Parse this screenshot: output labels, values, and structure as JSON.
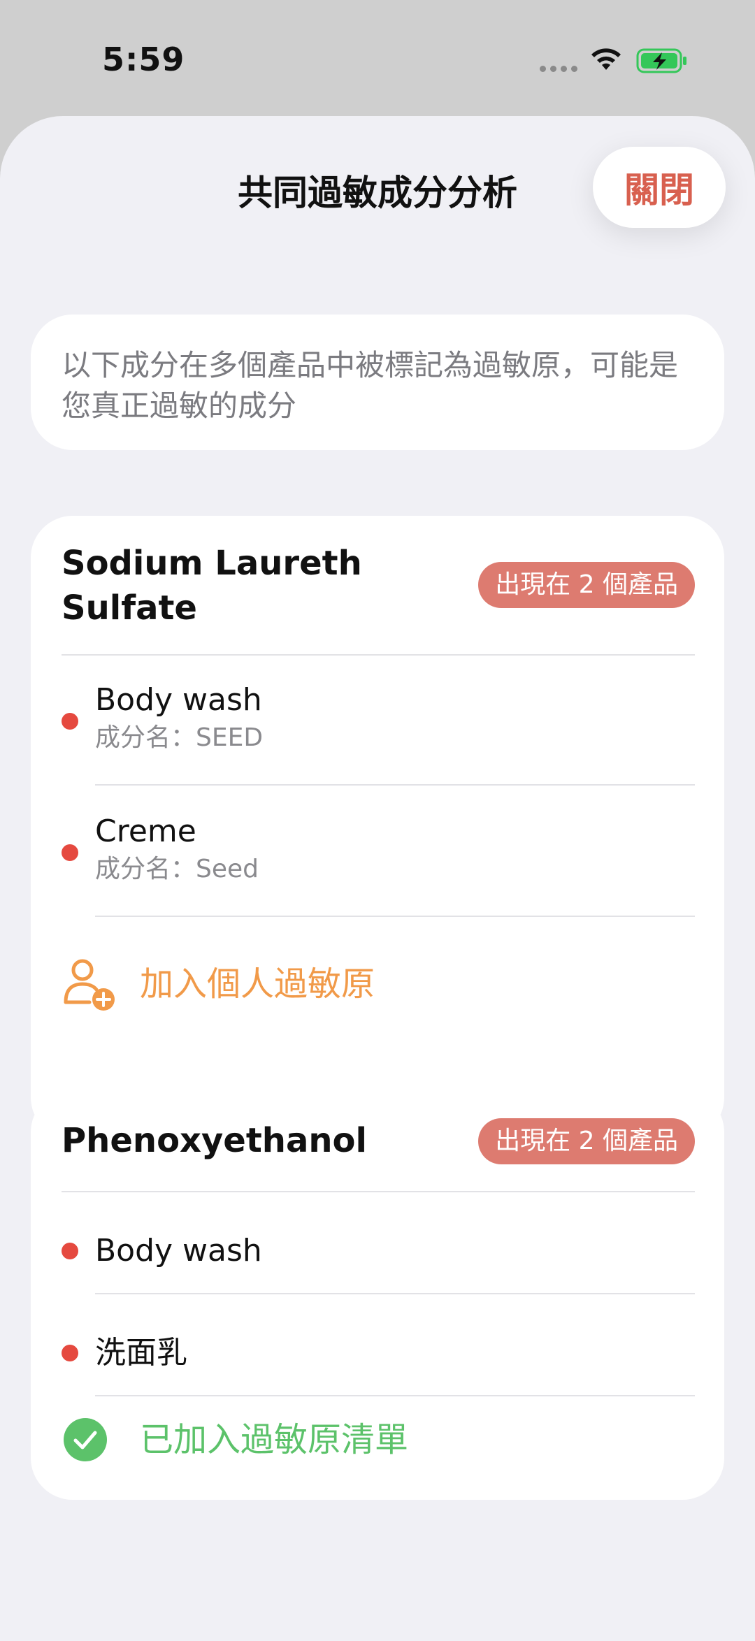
{
  "status_bar": {
    "time": "5:59",
    "icons": [
      "cellular-dots-icon",
      "wifi-icon",
      "battery-charging-icon"
    ]
  },
  "header": {
    "title": "共同過敏成分分析",
    "close_label": "關閉"
  },
  "info": {
    "text": "以下成分在多個產品中被標記為過敏原，可能是您真正過敏的成分"
  },
  "ingredients": [
    {
      "name": "Sodium Laureth Sulfate",
      "badge": "出現在 2 個產品",
      "products": [
        {
          "name": "Body wash",
          "subtitle": "成分名：SEED"
        },
        {
          "name": "Creme",
          "subtitle": "成分名：Seed"
        }
      ],
      "action_label": "加入個人過敏原",
      "action_icon": "add-person-icon"
    },
    {
      "name": "Phenoxyethanol",
      "badge": "出現在 2 個產品",
      "products": [
        {
          "name": "Body wash"
        },
        {
          "name": "洗面乳"
        }
      ],
      "action_label": "已加入過敏原清單",
      "action_icon": "checkmark-circle-icon"
    }
  ],
  "colors": {
    "accent_red": "#d8604f",
    "badge_bg": "#dd7b70",
    "bullet": "#e5493f",
    "orange": "#f19a49",
    "green": "#5cc26a",
    "sheet_bg": "#f0f0f5"
  }
}
